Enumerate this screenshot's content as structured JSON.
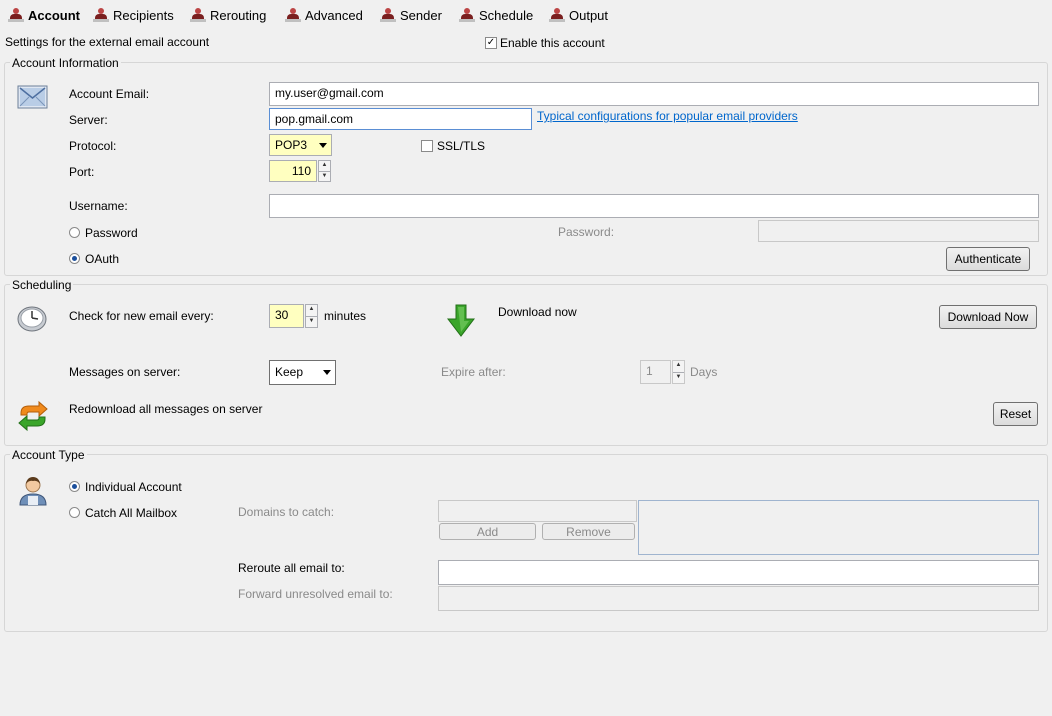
{
  "tabs": [
    {
      "label": "Account",
      "active": true
    },
    {
      "label": "Recipients"
    },
    {
      "label": "Rerouting"
    },
    {
      "label": "Advanced"
    },
    {
      "label": "Sender"
    },
    {
      "label": "Schedule"
    },
    {
      "label": "Output"
    }
  ],
  "header": {
    "description": "Settings for the external email account",
    "enable_label": "Enable this account",
    "enable_checked": true,
    "check_mark": "✓"
  },
  "account_info": {
    "legend": "Account Information",
    "email_label": "Account Email:",
    "email_value": "my.user@gmail.com",
    "server_label": "Server:",
    "server_value": "pop.gmail.com",
    "server_link": "Typical configurations for popular email providers",
    "protocol_label": "Protocol:",
    "protocol_value": "POP3",
    "ssl_label": "SSL/TLS",
    "port_label": "Port:",
    "port_value": "110",
    "username_label": "Username:",
    "username_value": "",
    "password_radio": "Password",
    "oauth_radio": "OAuth",
    "password_field_label": "Password:",
    "authenticate_button": "Authenticate",
    "auth_mode": "OAuth"
  },
  "scheduling": {
    "legend": "Scheduling",
    "check_label": "Check for new email every:",
    "check_value": "30",
    "minutes_label": "minutes",
    "download_now_label": "Download now",
    "download_now_button": "Download Now",
    "messages_label": "Messages on server:",
    "messages_value": "Keep",
    "expire_label": "Expire after:",
    "expire_value": "1",
    "days_label": "Days",
    "redownload_label": "Redownload all messages on server",
    "reset_button": "Reset"
  },
  "account_type": {
    "legend": "Account Type",
    "individual_radio": "Individual Account",
    "catchall_radio": "Catch All Mailbox",
    "selected": "Individual Account",
    "domains_label": "Domains to catch:",
    "add_button": "Add",
    "remove_button": "Remove",
    "reroute_label": "Reroute all email to:",
    "reroute_value": "",
    "forward_label": "Forward unresolved email to:",
    "forward_value": ""
  },
  "colors": {
    "background": "#f0f0f0",
    "link": "#0066cc",
    "highlight_field": "#ffffc0",
    "download_arrow": "#3aa52a"
  }
}
